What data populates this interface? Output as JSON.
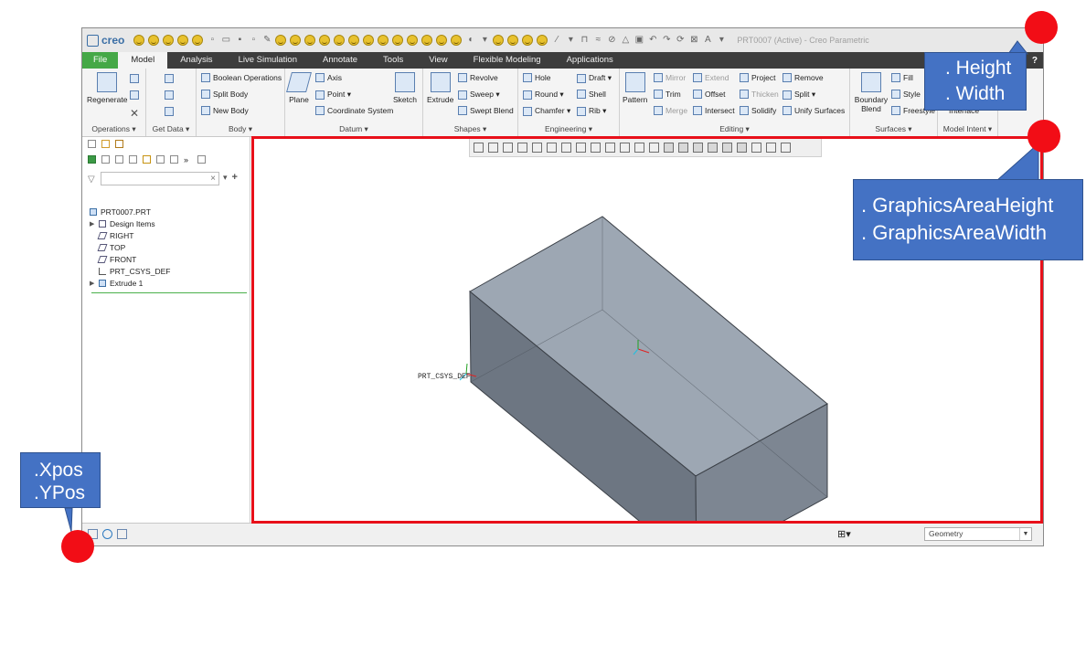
{
  "app": {
    "logo_text": "creo",
    "window_title": "PRT0007 (Active) - Creo Parametric"
  },
  "tabs": [
    {
      "label": "File"
    },
    {
      "label": "Model"
    },
    {
      "label": "Analysis"
    },
    {
      "label": "Live Simulation"
    },
    {
      "label": "Annotate"
    },
    {
      "label": "Tools"
    },
    {
      "label": "View"
    },
    {
      "label": "Flexible Modeling"
    },
    {
      "label": "Applications"
    }
  ],
  "help_label": "?",
  "ribbon": {
    "operations": {
      "label": "Operations ▾",
      "regenerate": "Regenerate"
    },
    "get_data": {
      "label": "Get Data ▾"
    },
    "body": {
      "label": "Body ▾",
      "boolean": "Boolean Operations",
      "split": "Split Body",
      "new": "New Body"
    },
    "datum": {
      "label": "Datum ▾",
      "plane": "Plane",
      "axis": "Axis",
      "point": "Point ▾",
      "csys": "Coordinate System",
      "sketch": "Sketch"
    },
    "shapes": {
      "label": "Shapes ▾",
      "extrude": "Extrude",
      "revolve": "Revolve",
      "sweep": "Sweep ▾",
      "swept_blend": "Swept Blend"
    },
    "engineering": {
      "label": "Engineering ▾",
      "hole": "Hole",
      "round": "Round ▾",
      "chamfer": "Chamfer ▾",
      "draft": "Draft ▾",
      "shell": "Shell",
      "rib": "Rib ▾"
    },
    "editing": {
      "label": "Editing ▾",
      "pattern": "Pattern",
      "mirror": "Mirror",
      "trim": "Trim",
      "merge": "Merge",
      "extend": "Extend",
      "offset": "Offset",
      "intersect": "Intersect",
      "project": "Project",
      "thicken": "Thicken",
      "solidify": "Solidify",
      "remove": "Remove",
      "split": "Split ▾",
      "unify": "Unify Surfaces"
    },
    "surfaces": {
      "label": "Surfaces ▾",
      "boundary": "Boundary Blend",
      "fill": "Fill",
      "style": "Style",
      "freestyle": "Freestyle"
    },
    "model_intent": {
      "label": "Model Intent ▾",
      "interface": "Interface"
    }
  },
  "model_tree": {
    "items": [
      {
        "label": "PRT0007.PRT"
      },
      {
        "label": "Design Items"
      },
      {
        "label": "RIGHT"
      },
      {
        "label": "TOP"
      },
      {
        "label": "FRONT"
      },
      {
        "label": "PRT_CSYS_DEF"
      },
      {
        "label": "Extrude 1"
      }
    ]
  },
  "graphics": {
    "csys_label": "PRT_CSYS_DEF"
  },
  "status": {
    "filter_value": "Geometry"
  },
  "annotations": {
    "height_width": {
      "line1": ". Height",
      "line2": ". Width"
    },
    "graphics_area": {
      "line1": ". GraphicsAreaHeight",
      "line2": ". GraphicsAreaWidth"
    },
    "pos": {
      "line1": ".Xpos",
      "line2": ".YPos"
    }
  },
  "colors": {
    "annotation_red": "#f20d16",
    "callout_blue": "#4472c4",
    "file_tab_green": "#45a847",
    "tab_bar": "#3d3d3d"
  }
}
